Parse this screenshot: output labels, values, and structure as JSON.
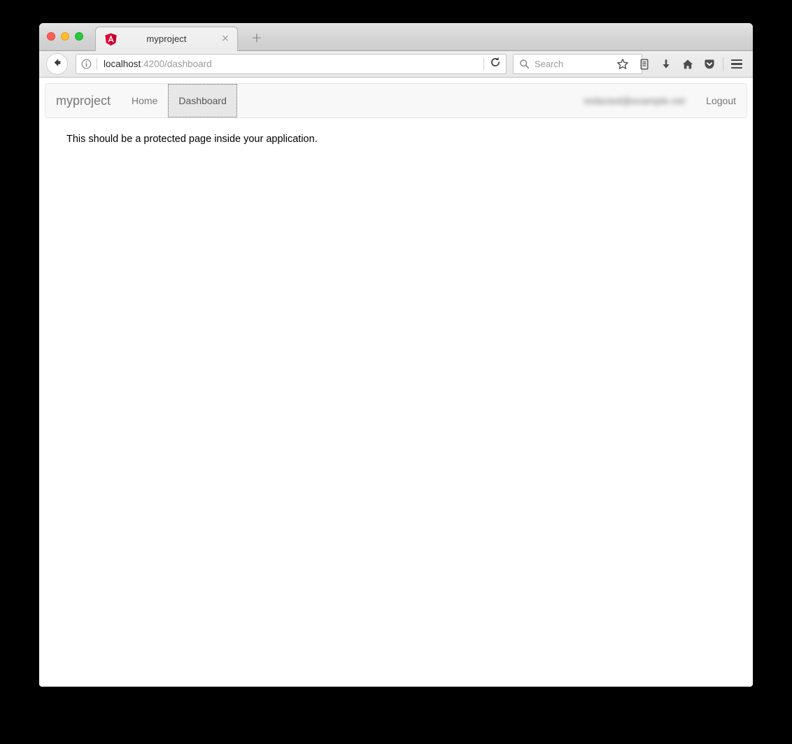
{
  "window": {
    "traffic_lights": [
      "close",
      "minimize",
      "zoom"
    ]
  },
  "browser": {
    "tab": {
      "title": "myproject",
      "favicon": "angular-logo-icon",
      "close_label": "×"
    },
    "new_tab_label": "+",
    "back_icon": "back-arrow-icon",
    "identity_icon": "page-info-icon",
    "url": {
      "host": "localhost",
      "rest": ":4200/dashboard",
      "full": "localhost:4200/dashboard"
    },
    "reload_icon": "reload-icon",
    "search": {
      "placeholder": "Search",
      "icon": "search-icon"
    },
    "toolbar_icons": [
      "bookmark-star-icon",
      "library-icon",
      "downloads-icon",
      "home-icon",
      "pocket-icon"
    ],
    "menu_icon": "hamburger-menu-icon"
  },
  "app": {
    "brand": "myproject",
    "nav_items": [
      {
        "label": "Home",
        "active": false
      },
      {
        "label": "Dashboard",
        "active": true
      }
    ],
    "user_email": "redacted@example.net",
    "logout_label": "Logout",
    "content_message": "This should be a protected page inside your application."
  },
  "colors": {
    "page_background": "#000000",
    "navbar_background": "#f8f8f8",
    "navbar_border": "#e7e7e7",
    "nav_active_background": "#e7e7e7",
    "nav_text": "#777777",
    "angular_red": "#dd0031",
    "traffic_red": "#ff5f57",
    "traffic_yellow": "#ffbd2e",
    "traffic_green": "#28c840"
  }
}
